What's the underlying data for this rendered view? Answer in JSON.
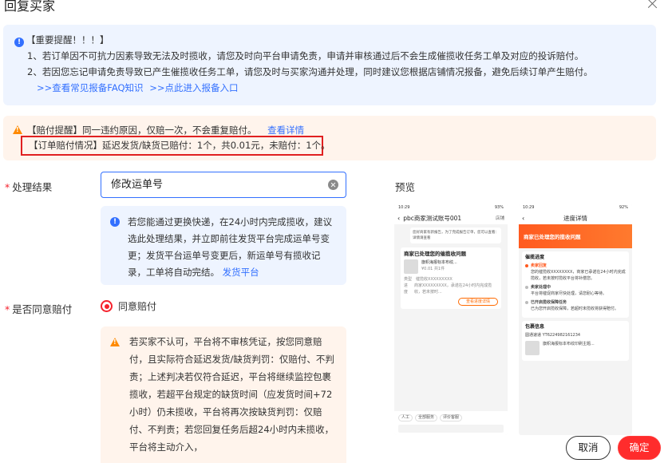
{
  "dialog": {
    "title": "回复买家"
  },
  "important_notice": {
    "title": "【重要提醒！！！】",
    "line1": "1、若订单因不可抗力因素导致无法及时揽收，请您及时向平台申请免责，申请并审核通过后不会生成催揽收任务工单及对应的投诉赔付。",
    "line2": "2、若因您忘记申请免责导致已产生催揽收任务工单，请您及时与买家沟通并处理，同时建议您根据店铺情况报备，避免后续订单产生赔付。",
    "link_faq": ">>查看常见报备FAQ知识",
    "link_entry": ">>点此进入报备入口"
  },
  "compensation_notice": {
    "text": "【赔付提醒】同一违约原因，仅赔一次，不会重复赔付。",
    "link_details": "查看详情",
    "order_status": "【订单赔付情况】延迟发货/缺货已赔付：1个，共0.01元，未赔付：1个。"
  },
  "form": {
    "result_label": "处理结果",
    "result_value": "修改运单号",
    "result_hint": "若您能通过更换快递，在24小时内完成揽收，建议选此处理结果，并立即前往发货平台完成运单号变更；发货平台运单号变更后，新运单号有揽收记录，工单将自动完结。",
    "result_hint_link": "发货平台",
    "agree_label": "是否同意赔付",
    "agree_option": "同意赔付",
    "agree_warning": "若买家不认可，平台将不审核凭证，按您同意赔付，且实际符合延迟发货/缺货判罚：仅赔付、不判责；上述判决若仅符合延迟，平台将继续监控包裹揽收，若超平台规定的缺货时间（应发货时间+72小时）仍未揽收，平台将再次按缺货判罚：仅赔付、不判责；若您回复任务后超24小时内未揽收，平台将主动介入，"
  },
  "preview": {
    "label": "预览",
    "phone1": {
      "time": "10:29",
      "battery": "93%",
      "title": "pbc商家测试账号001",
      "store": "店铺",
      "msg1": "您好商家有新报告，为了完成报告订单，您可以查看：详情请查看",
      "card_title": "商家已处理您的催揽收问题",
      "product": "旗帜海报标本布纹...",
      "price": "¥0.01",
      "qty": "共1件",
      "row1a": "类型",
      "row1b": "催揽收XXXXXXXXX",
      "row2a": "进度",
      "row2b": "商家XXXXXXXXX，承诺在24小时内完成揽收，若未按时...",
      "btn": "查看进度详情",
      "pill1": "人工",
      "pill2": "全部服务",
      "pill3": "评价客服"
    },
    "phone2": {
      "time": "10:29",
      "battery": "92%",
      "title": "进度详情",
      "banner": "商家已处理您的揽收问题",
      "sec1": "催揽进度",
      "tl1_title": "卖家回复",
      "tl1_text": "您的催揽收XXXXXXXX，商家已承诺在24小时内完成揽收，若未按时揽收平台将补偿您。",
      "tl2_title": "卖家处理中",
      "tl2_text": "平台将催促商家尽快处理，请您耐心等待。",
      "tl3_title": "已开启揽收保障任务",
      "tl3_text": "已为您开启揽收保障，若超时未揽收将获得赔付。",
      "sec2": "包裹信息",
      "waybill": "圆通速递 YT6224982161234",
      "product": "旗帜海报标本布纹印刷主题..."
    }
  },
  "footer": {
    "cancel": "取消",
    "confirm": "确定"
  }
}
